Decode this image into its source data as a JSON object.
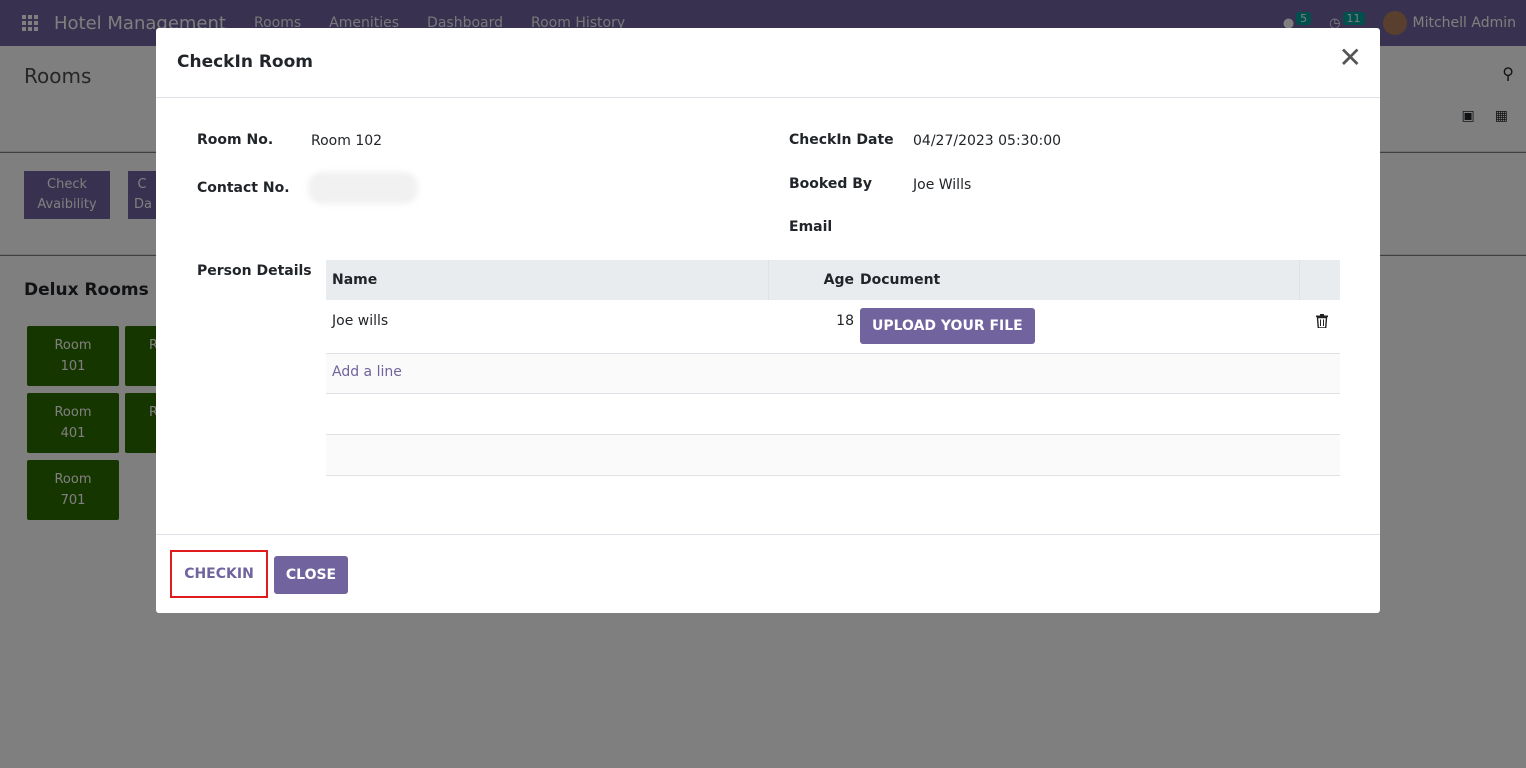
{
  "topbar": {
    "brand": "Hotel Management",
    "menu": [
      "Rooms",
      "Amenities",
      "Dashboard",
      "Room History"
    ],
    "messages_count": "5",
    "activities_count": "11",
    "user": "Mitchell Admin"
  },
  "control_panel": {
    "title": "Rooms"
  },
  "actions": {
    "check_availability": "Check\nAvaibility",
    "second_button_partial": "C\nDa"
  },
  "content": {
    "section_title": "Delux Rooms",
    "rooms": [
      "Room\n101",
      "R",
      "Room\n401",
      "R",
      "Room\n701"
    ]
  },
  "modal": {
    "title": "CheckIn Room",
    "fields": {
      "room_no_label": "Room No.",
      "room_no_value": "Room 102",
      "contact_no_label": "Contact No.",
      "checkin_date_label": "CheckIn Date",
      "checkin_date_value": "04/27/2023 05:30:00",
      "booked_by_label": "Booked By",
      "booked_by_value": "Joe Wills",
      "email_label": "Email",
      "person_details_label": "Person Details"
    },
    "table": {
      "headers": [
        "Name",
        "Age",
        "Document"
      ],
      "rows": [
        {
          "name": "Joe wills",
          "age": "18",
          "document_button": "UPLOAD YOUR FILE"
        }
      ],
      "add_line": "Add a line"
    },
    "footer": {
      "checkin_label": "CHECKIN",
      "close_label": "CLOSE"
    }
  },
  "colors": {
    "primary": "#71639e",
    "room_tile": "#2d6c00",
    "highlight_border": "#e01b1b"
  }
}
